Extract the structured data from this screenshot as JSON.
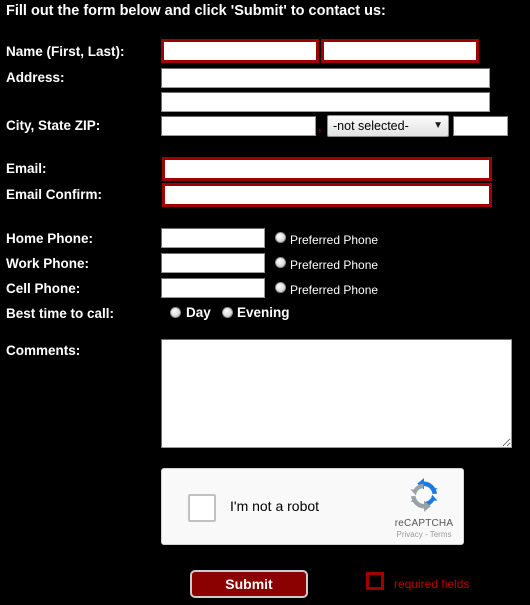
{
  "page": {
    "background_color": "#000000",
    "text_color": "#ffffff",
    "required_border_color": "#a00000",
    "submit_bg_color": "#8b0000",
    "required_text_color": "#bb0000"
  },
  "heading": "Fill out the form below and click 'Submit' to contact us:",
  "fields": {
    "name": {
      "label": "Name (First, Last):",
      "first": {
        "value": "",
        "placeholder": "",
        "required": true
      },
      "last": {
        "value": "",
        "placeholder": "",
        "required": true
      }
    },
    "address": {
      "label": "Address:",
      "line1": {
        "value": "",
        "placeholder": "",
        "required": false
      },
      "line2": {
        "value": "",
        "placeholder": "",
        "required": false
      }
    },
    "city_state_zip": {
      "label": "City, State ZIP:",
      "city": {
        "value": "",
        "placeholder": "",
        "required": false
      },
      "separator": ",",
      "state": {
        "selected": "-not selected-",
        "arrow_icon": "chevron-down-icon",
        "options": [
          "-not selected-"
        ]
      },
      "zip": {
        "value": "",
        "placeholder": "",
        "required": false
      }
    },
    "email": {
      "label": "Email:",
      "value": "",
      "placeholder": "",
      "required": true
    },
    "email_confirm": {
      "label": "Email Confirm:",
      "value": "",
      "placeholder": "",
      "required": true
    },
    "home_phone": {
      "label": "Home Phone:",
      "value": "",
      "placeholder": "",
      "preferred_label": "Preferred Phone",
      "preferred_checked": false
    },
    "work_phone": {
      "label": "Work Phone:",
      "value": "",
      "placeholder": "",
      "preferred_label": "Preferred Phone",
      "preferred_checked": false
    },
    "cell_phone": {
      "label": "Cell Phone:",
      "value": "",
      "placeholder": "",
      "preferred_label": "Preferred Phone",
      "preferred_checked": false
    },
    "best_time": {
      "label": "Best time to call:",
      "options": [
        {
          "label": "Day",
          "checked": false
        },
        {
          "label": "Evening",
          "checked": false
        }
      ]
    },
    "comments": {
      "label": "Comments:",
      "value": "",
      "placeholder": ""
    }
  },
  "recaptcha": {
    "checkbox_label": "I'm not a robot",
    "checked": false,
    "brand": "reCAPTCHA",
    "terms": "Privacy - Terms",
    "logo_icon": "recaptcha-logo-icon"
  },
  "footer": {
    "submit_label": "Submit",
    "required_note": "required fields"
  }
}
